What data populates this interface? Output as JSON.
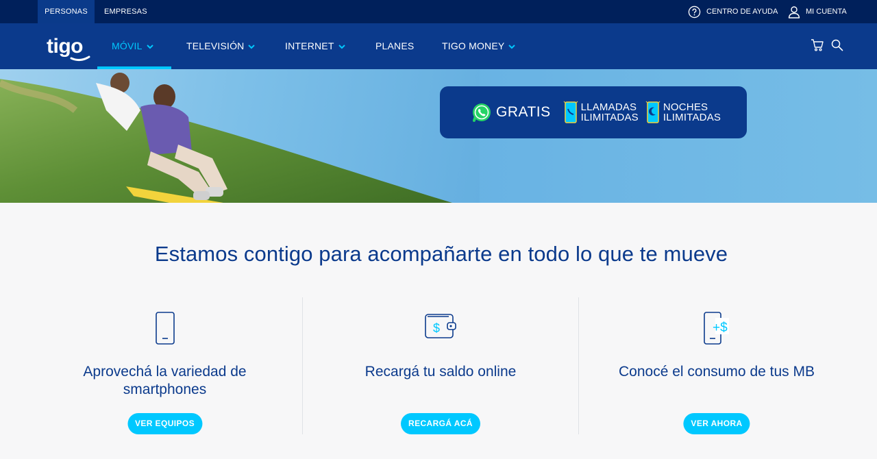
{
  "topbar": {
    "segments": [
      "PERSONAS",
      "EMPRESAS"
    ],
    "help_label": "CENTRO DE AYUDA",
    "account_label": "MI CUENTA"
  },
  "nav": {
    "logo_text": "tigo",
    "items": [
      "MÓVIL",
      "TELEVISIÓN",
      "INTERNET",
      "PLANES",
      "TIGO MONEY"
    ],
    "active": "MÓVIL"
  },
  "hero": {
    "promo": {
      "gratis": "GRATIS",
      "llamadas_1": "LLAMADAS",
      "llamadas_2": "ILIMITADAS",
      "noches_1": "NOCHES",
      "noches_2": "ILIMITADAS"
    }
  },
  "main": {
    "headline": "Estamos contigo para acompañarte en todo lo que te mueve",
    "features": [
      {
        "icon": "smartphone-icon",
        "title": "Aprovechá la variedad de smartphones",
        "cta": "VER EQUIPOS"
      },
      {
        "icon": "wallet-icon",
        "title": "Recargá tu saldo online",
        "cta": "RECARGÁ ACÁ"
      },
      {
        "icon": "phone-balance-icon",
        "title": "Conocé el consumo de tus MB",
        "cta": "VER AHORA"
      }
    ]
  },
  "colors": {
    "navy": "#00205b",
    "brand_blue": "#0b3a8c",
    "accent_cyan": "#00c8ff"
  }
}
